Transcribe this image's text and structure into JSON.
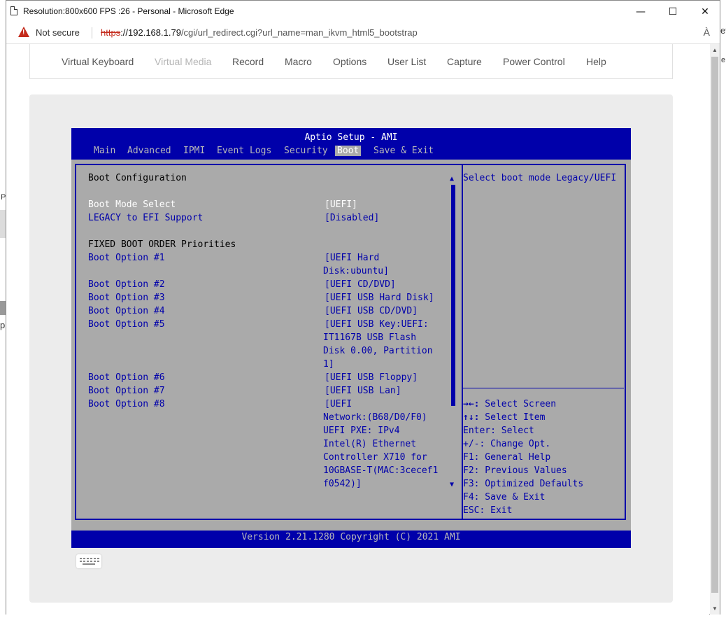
{
  "browser": {
    "title": "Resolution:800x600 FPS :26 - Personal - Microsoft Edge",
    "controls": {
      "minimize": "—",
      "maximize": "☐",
      "close": "✕"
    },
    "security": "Not secure",
    "url_scheme": "https",
    "url_host": "://192.168.1.79",
    "url_path": "/cgi/url_redirect.cgi?url_name=man_ikvm_html5_bootstrap",
    "read_aloud_glyph": "À"
  },
  "kvm_menu": [
    "Virtual Keyboard",
    "Virtual Media",
    "Record",
    "Macro",
    "Options",
    "User List",
    "Capture",
    "Power Control",
    "Help"
  ],
  "kvm_menu_disabled": [
    "Virtual Media"
  ],
  "bios": {
    "title": "Aptio Setup - AMI",
    "tabs": [
      "Main",
      "Advanced",
      "IPMI",
      "Event Logs",
      "Security",
      "Boot",
      "Save & Exit"
    ],
    "active_tab": "Boot",
    "section_title": "Boot Configuration",
    "boot_mode_label": "Boot Mode Select",
    "boot_mode_value": "[UEFI]",
    "legacy_label": "LEGACY to EFI Support",
    "legacy_value": "[Disabled]",
    "priorities_title": "FIXED BOOT ORDER Priorities",
    "options": [
      {
        "label": "Boot Option #1",
        "value": [
          "[UEFI Hard",
          "Disk:ubuntu]"
        ]
      },
      {
        "label": "Boot Option #2",
        "value": [
          "[UEFI CD/DVD]"
        ]
      },
      {
        "label": "Boot Option #3",
        "value": [
          "[UEFI USB Hard Disk]"
        ]
      },
      {
        "label": "Boot Option #4",
        "value": [
          "[UEFI USB CD/DVD]"
        ]
      },
      {
        "label": "Boot Option #5",
        "value": [
          "[UEFI USB Key:UEFI:",
          "IT1167B USB Flash",
          "Disk 0.00, Partition",
          "1]"
        ]
      },
      {
        "label": "Boot Option #6",
        "value": [
          "[UEFI USB Floppy]"
        ]
      },
      {
        "label": "Boot Option #7",
        "value": [
          "[UEFI USB Lan]"
        ]
      },
      {
        "label": "Boot Option #8",
        "value": [
          "[UEFI",
          "Network:(B68/D0/F0)",
          "UEFI PXE: IPv4",
          "Intel(R) Ethernet",
          "Controller X710 for",
          "10GBASE-T(MAC:3cecef1",
          "f0542)]"
        ]
      }
    ],
    "help_text": "Select boot mode Legacy/UEFI",
    "keys": [
      {
        "key": "→←:",
        "desc": " Select Screen"
      },
      {
        "key": "↑↓:",
        "desc": " Select Item"
      },
      {
        "key": "Enter:",
        "desc": " Select"
      },
      {
        "key": "+/-:",
        "desc": " Change Opt."
      },
      {
        "key": "F1:",
        "desc": " General Help"
      },
      {
        "key": "F2:",
        "desc": " Previous Values"
      },
      {
        "key": "F3:",
        "desc": " Optimized Defaults"
      },
      {
        "key": "F4:",
        "desc": " Save & Exit"
      },
      {
        "key": "ESC:",
        "desc": " Exit"
      }
    ],
    "footer": "Version 2.21.1280 Copyright (C) 2021 AMI"
  },
  "background_peek": [
    "P",
    "p",
    "et",
    "e"
  ]
}
